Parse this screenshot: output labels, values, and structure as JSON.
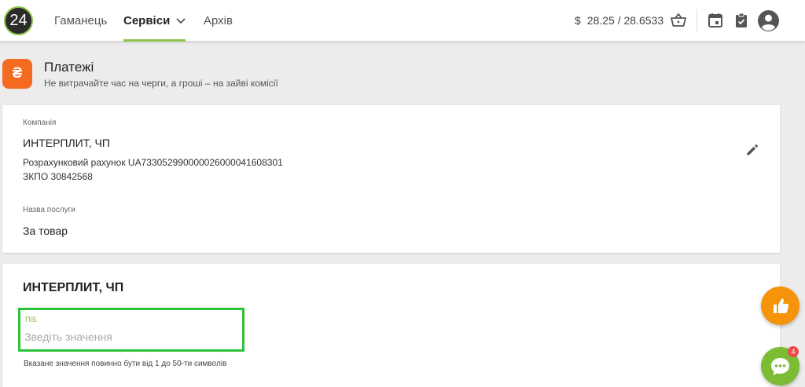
{
  "header": {
    "logo_text": "24",
    "nav": [
      {
        "label": "Гаманець",
        "active": false
      },
      {
        "label": "Сервіси",
        "active": true
      },
      {
        "label": "Архів",
        "active": false
      }
    ],
    "currency_symbol": "$",
    "rate": "28.25 / 28.6533",
    "accent_color": "#8bc34a"
  },
  "page": {
    "badge_symbol": "₴",
    "title": "Платежі",
    "subtitle": "Не витрачайте час на черги, а гроші – на зайві комісії"
  },
  "company_card": {
    "company_label": "Компанія",
    "company_name": "ИНТЕРПЛИТ, ЧП",
    "account_label": "Розрахунковий рахунок",
    "account_value": "UA733052990000026000041608301",
    "edrpou_label": "ЗКПО",
    "edrpou_value": "30842568",
    "service_label": "Назва послуги",
    "service_value": "За товар"
  },
  "form_card": {
    "title": "ИНТЕРПЛИТ, ЧП",
    "field_label": "ПІБ",
    "field_placeholder": "Зведіть значення",
    "field_value": "",
    "hint": "Вказане значення повинно бути від 1 до 50-ти символів"
  },
  "floating": {
    "chat_badge_count": "4",
    "like_color": "#f5930b",
    "chat_color": "#7cbb34"
  }
}
